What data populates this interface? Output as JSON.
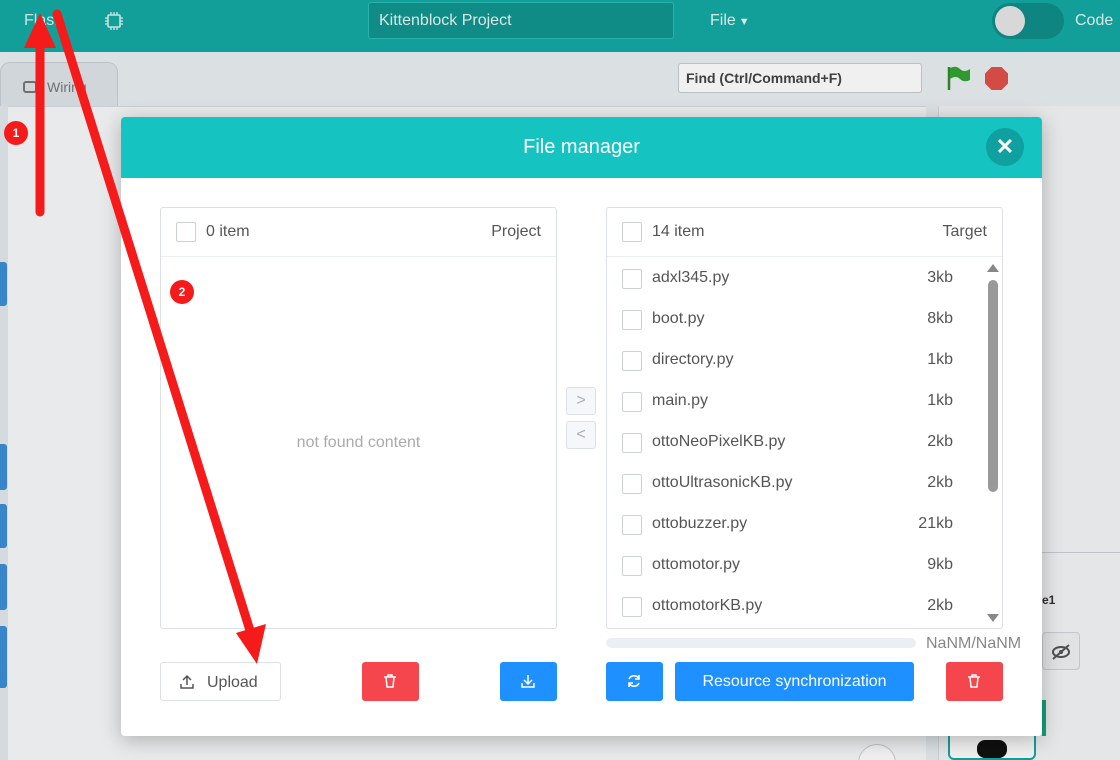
{
  "topbar": {
    "flash_label": "Flash",
    "chip_icon": "chip-icon",
    "project_name": "Kittenblock Project",
    "file_menu": "File",
    "code_label": "Code"
  },
  "workspace": {
    "tab_label": "Wiring",
    "find_placeholder": "Find (Ctrl/Command+F)",
    "right_label": "e1"
  },
  "modal": {
    "title": "File manager",
    "close_icon": "close-icon",
    "left_panel": {
      "count": "0 item",
      "title": "Project",
      "empty_text": "not found content"
    },
    "right_panel": {
      "count": "14 item",
      "title": "Target",
      "files": [
        {
          "name": "adxl345.py",
          "size": "3kb"
        },
        {
          "name": "boot.py",
          "size": "8kb"
        },
        {
          "name": "directory.py",
          "size": "1kb"
        },
        {
          "name": "main.py",
          "size": "1kb"
        },
        {
          "name": "ottoNeoPixelKB.py",
          "size": "2kb"
        },
        {
          "name": "ottoUltrasonicKB.py",
          "size": "2kb"
        },
        {
          "name": "ottobuzzer.py",
          "size": "21kb"
        },
        {
          "name": "ottomotor.py",
          "size": "9kb"
        },
        {
          "name": "ottomotorKB.py",
          "size": "2kb"
        }
      ]
    },
    "transfer_right": ">",
    "transfer_left": "<",
    "progress_text": "NaNM/NaNM",
    "progress_value": 0,
    "upload_label": "Upload",
    "sync_label": "Resource synchronization"
  },
  "annotations": {
    "badge_1": "1",
    "badge_2": "2"
  },
  "colors": {
    "topbar": "#14a9a3",
    "modal_header": "#15c3c1",
    "danger": "#f5464d",
    "primary": "#1e90ff",
    "annotation": "#f51b1b"
  }
}
